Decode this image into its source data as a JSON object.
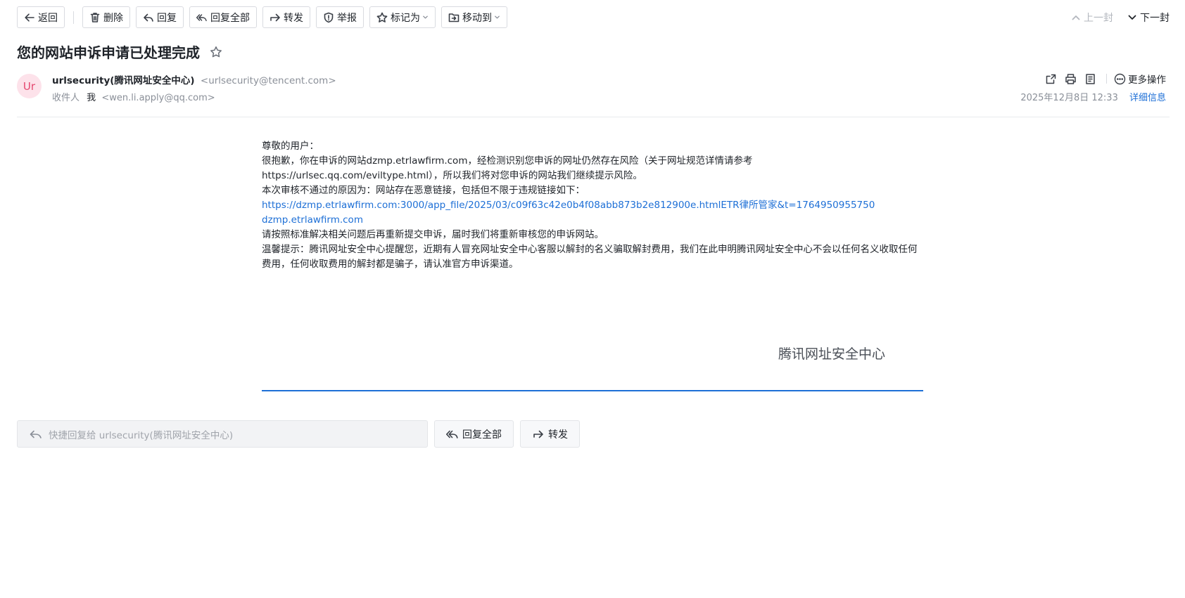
{
  "toolbar": {
    "back": "返回",
    "delete": "删除",
    "reply": "回复",
    "reply_all": "回复全部",
    "forward": "转发",
    "report": "举报",
    "mark_as": "标记为",
    "move_to": "移动到"
  },
  "nav": {
    "prev": "上一封",
    "next": "下一封"
  },
  "email": {
    "subject": "您的网站申诉申请已处理完成",
    "avatar_initials": "Ur",
    "sender_name": "urlsecurity(腾讯网址安全中心)",
    "sender_email": "<urlsecurity@tencent.com>",
    "recipient_label": "收件人",
    "recipient_name": "我",
    "recipient_email": "<wen.li.apply@qq.com>",
    "date": "2025年12月8日 12:33",
    "detail_link": "详细信息",
    "more_ops": "更多操作"
  },
  "body": {
    "greeting": "尊敬的用户：",
    "line1": "很抱歉，你在申诉的网站dzmp.etrlawfirm.com，经检测识别您申诉的网址仍然存在风险（关于网址规范详情请参考",
    "line2": "https://urlsec.qq.com/eviltype.html），所以我们将对您申诉的网站我们继续提示风险。",
    "line3": "本次审核不通过的原因为：网站存在恶意链接，包括但不限于违规链接如下：",
    "link1": "https://dzmp.etrlawfirm.com:3000/app_file/2025/03/c09f63c42e0b4f08abb873b2e812900e.htmlETR律所管家&t=1764950955750",
    "link2": "dzmp.etrlawfirm.com",
    "line4": "请按照标准解决相关问题后再重新提交申诉，届时我们将重新审核您的申诉网站。",
    "line5": "温馨提示：腾讯网址安全中心提醒您，近期有人冒充网址安全中心客服以解封的名义骗取解封费用，我们在此申明腾讯网址安全中心不会以任何名义收取任何费用，任何收取费用的解封都是骗子，请认准官方申诉渠道。",
    "signature": "腾讯网址安全中心"
  },
  "bottom": {
    "quick_reply_placeholder": "快捷回复给 urlsecurity(腾讯网址安全中心)",
    "reply_all": "回复全部",
    "forward": "转发"
  },
  "colors": {
    "link": "#1d6fd6",
    "avatar_bg": "#fde2ea",
    "avatar_text": "#e5476f",
    "divider": "#1d6fd6"
  }
}
